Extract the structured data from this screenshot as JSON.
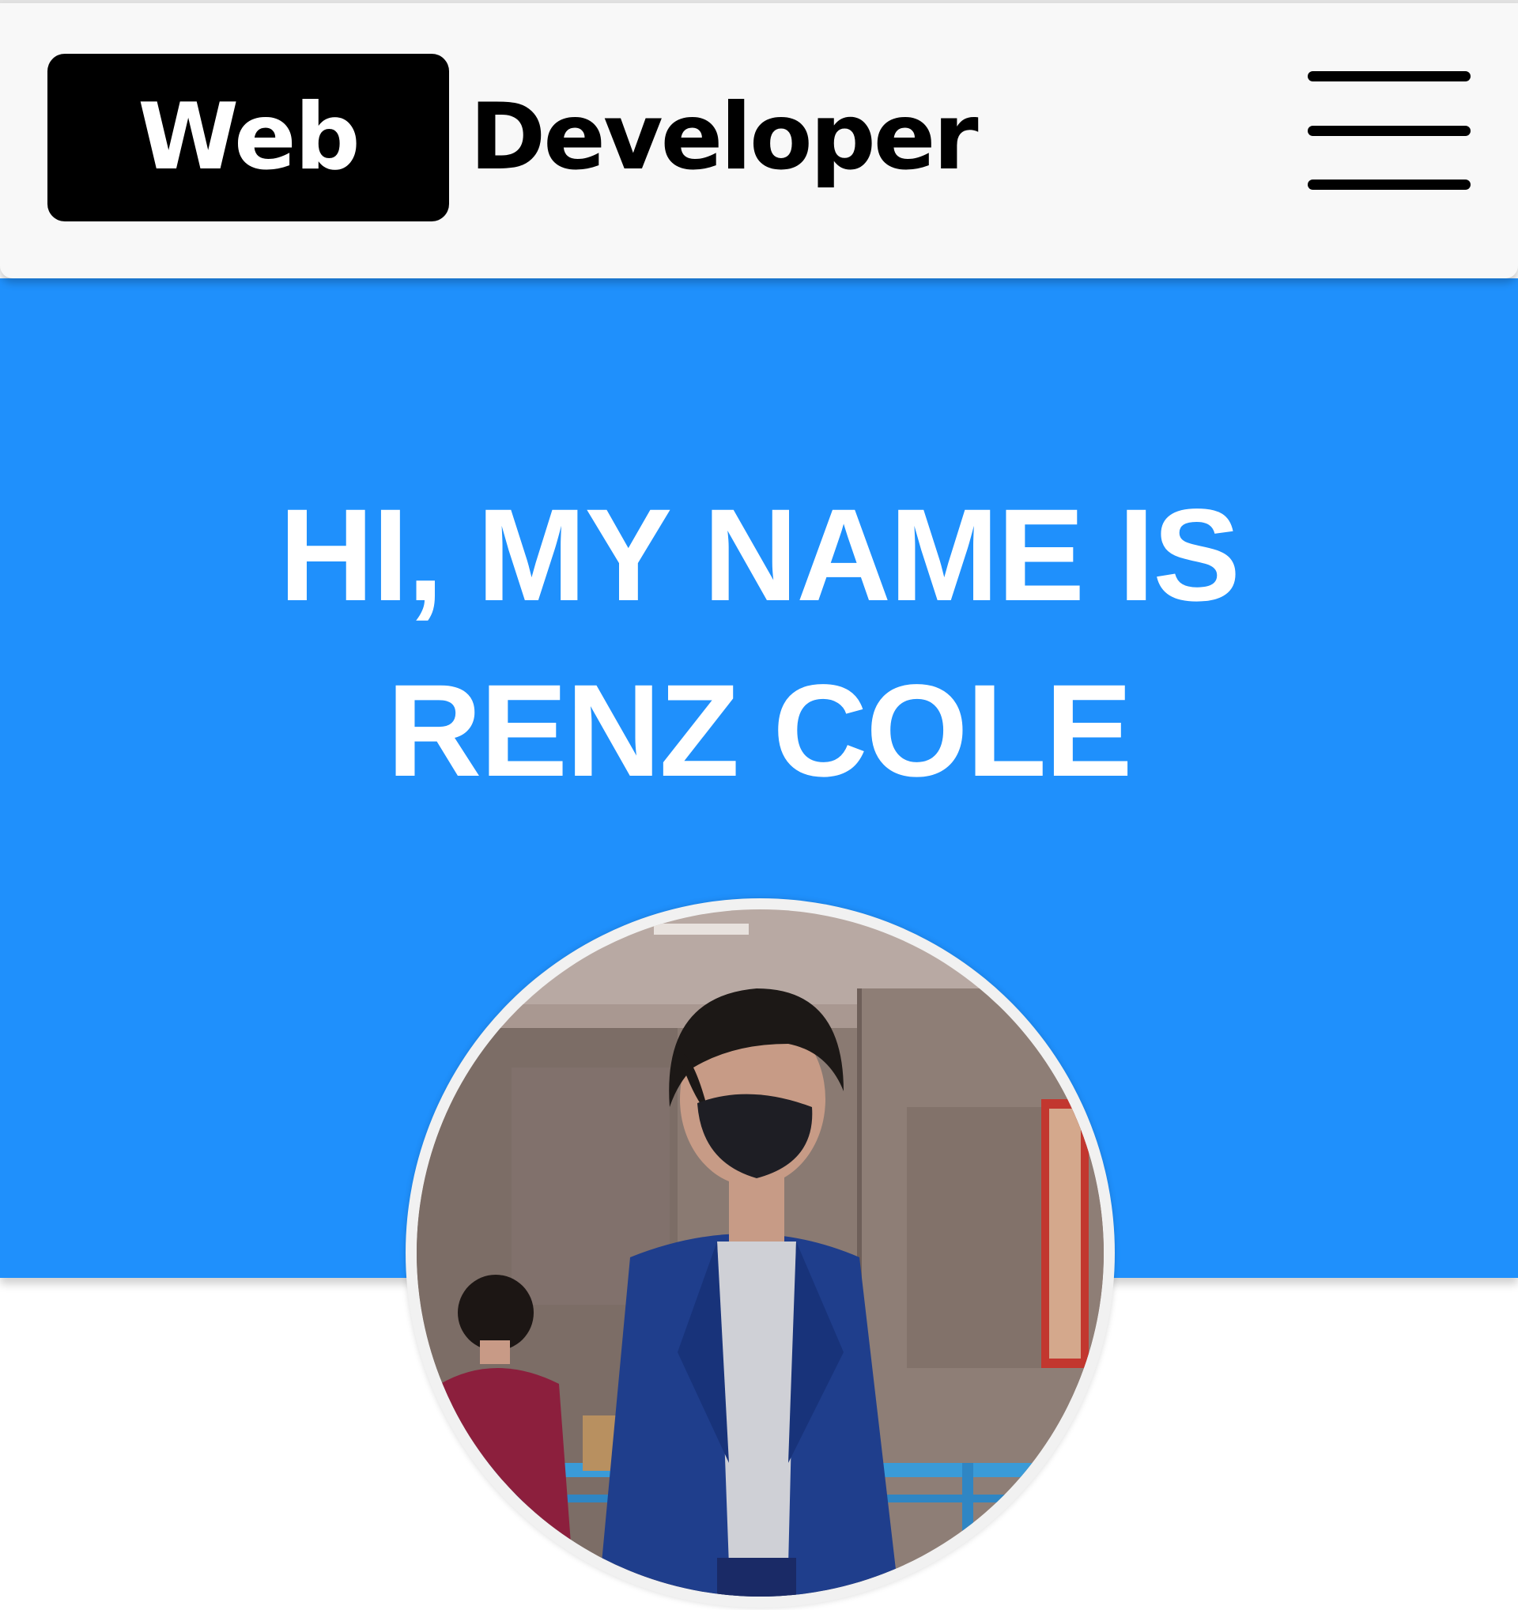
{
  "header": {
    "brand_badge": "Web",
    "brand_text": "Developer",
    "menu_icon": "hamburger-menu-icon"
  },
  "hero": {
    "line1": "HI, MY NAME IS",
    "line2": "RENZ COLE"
  },
  "avatar": {
    "shape": "circle"
  },
  "colors": {
    "hero_background": "#1f90fc",
    "navbar_background": "#f8f8f8",
    "brand_badge_background": "#000000",
    "text_on_hero": "#ffffff"
  }
}
